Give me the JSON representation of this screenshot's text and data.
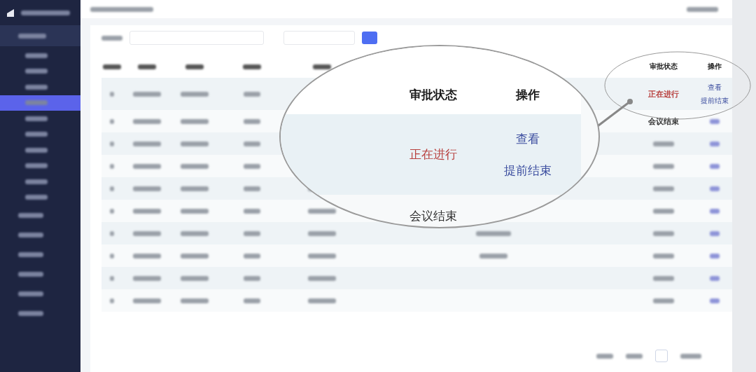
{
  "sidebar": {
    "items": [
      {
        "selected": false
      },
      {
        "selected": false
      },
      {
        "selected": false
      },
      {
        "selected": true
      },
      {
        "selected": false
      },
      {
        "selected": false
      },
      {
        "selected": false
      },
      {
        "selected": false
      },
      {
        "selected": false
      },
      {
        "selected": false
      }
    ]
  },
  "table": {
    "columns": [
      {
        "label": "审批状态"
      },
      {
        "label": "操作"
      }
    ],
    "rows": [
      {
        "status": "正在进行",
        "color": "#b8413f",
        "actions": [
          "查看",
          "提前结束"
        ]
      },
      {
        "status": "会议结束",
        "color": "#333333",
        "actions": []
      }
    ]
  },
  "magnifier": {
    "columns": [
      {
        "label": "审批状态"
      },
      {
        "label": "操作"
      }
    ],
    "rows": [
      {
        "status": "正在进行",
        "color": "#b8413f",
        "actions": [
          "查看",
          "提前结束"
        ]
      },
      {
        "status": "会议结束",
        "color": "#333333",
        "actions": []
      }
    ]
  }
}
